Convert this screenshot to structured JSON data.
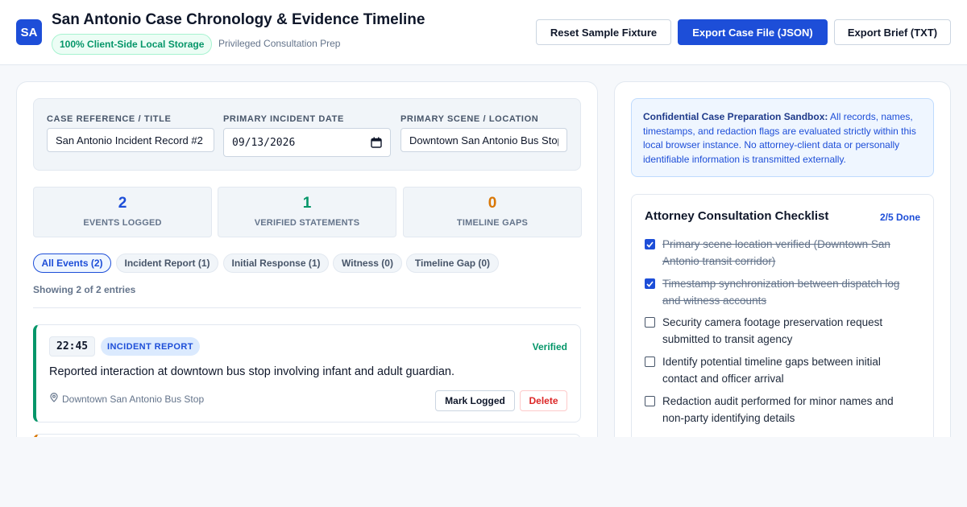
{
  "header": {
    "logo": "SA",
    "title": "San Antonio Case Chronology & Evidence Timeline",
    "storage_badge": "100% Client-Side Local Storage",
    "subtitle": "Privileged Consultation Prep",
    "buttons": {
      "reset": "Reset Sample Fixture",
      "export_json": "Export Case File (JSON)",
      "export_txt": "Export Brief (TXT)"
    }
  },
  "case_fields": {
    "title_label": "CASE REFERENCE / TITLE",
    "title_value": "San Antonio Incident Record #2",
    "date_label": "PRIMARY INCIDENT DATE",
    "date_value": "09/13/2026",
    "location_label": "PRIMARY SCENE / LOCATION",
    "location_value": "Downtown San Antonio Bus Stop"
  },
  "stats": [
    {
      "value": "2",
      "label": "EVENTS LOGGED",
      "color": "#1d4ed8"
    },
    {
      "value": "1",
      "label": "VERIFIED STATEMENTS",
      "color": "#059669"
    },
    {
      "value": "0",
      "label": "TIMELINE GAPS",
      "color": "#d97706"
    }
  ],
  "filters": [
    {
      "label": "All Events (2)",
      "active": true
    },
    {
      "label": "Incident Report (1)",
      "active": false
    },
    {
      "label": "Initial Response (1)",
      "active": false
    },
    {
      "label": "Witness (0)",
      "active": false
    },
    {
      "label": "Timeline Gap (0)",
      "active": false
    }
  ],
  "showing_text": "Showing 2 of 2 entries",
  "events": [
    {
      "time": "22:45",
      "type": "INCIDENT REPORT",
      "status": "Verified",
      "description": "Reported interaction at downtown bus stop involving infant and adult guardian.",
      "location": "Downtown San Antonio Bus Stop",
      "mark_label": "Mark Logged",
      "delete_label": "Delete"
    }
  ],
  "notice": {
    "strong": "Confidential Case Preparation Sandbox:",
    "text": " All records, names, timestamps, and redaction flags are evaluated strictly within this local browser instance. No attorney-client data or personally identifiable information is transmitted externally."
  },
  "checklist": {
    "title": "Attorney Consultation Checklist",
    "count": "2/5 Done",
    "items": [
      {
        "text": "Primary scene location verified (Downtown San Antonio transit corridor)",
        "checked": true
      },
      {
        "text": "Timestamp synchronization between dispatch log and witness accounts",
        "checked": true
      },
      {
        "text": "Security camera footage preservation request submitted to transit agency",
        "checked": false
      },
      {
        "text": "Identify potential timeline gaps between initial contact and officer arrival",
        "checked": false
      },
      {
        "text": "Redaction audit performed for minor names and non-party identifying details",
        "checked": false
      }
    ]
  },
  "colors": {
    "primary": "#1d4ed8",
    "verified": "#059669",
    "gap": "#d97706",
    "danger": "#dc2626"
  }
}
